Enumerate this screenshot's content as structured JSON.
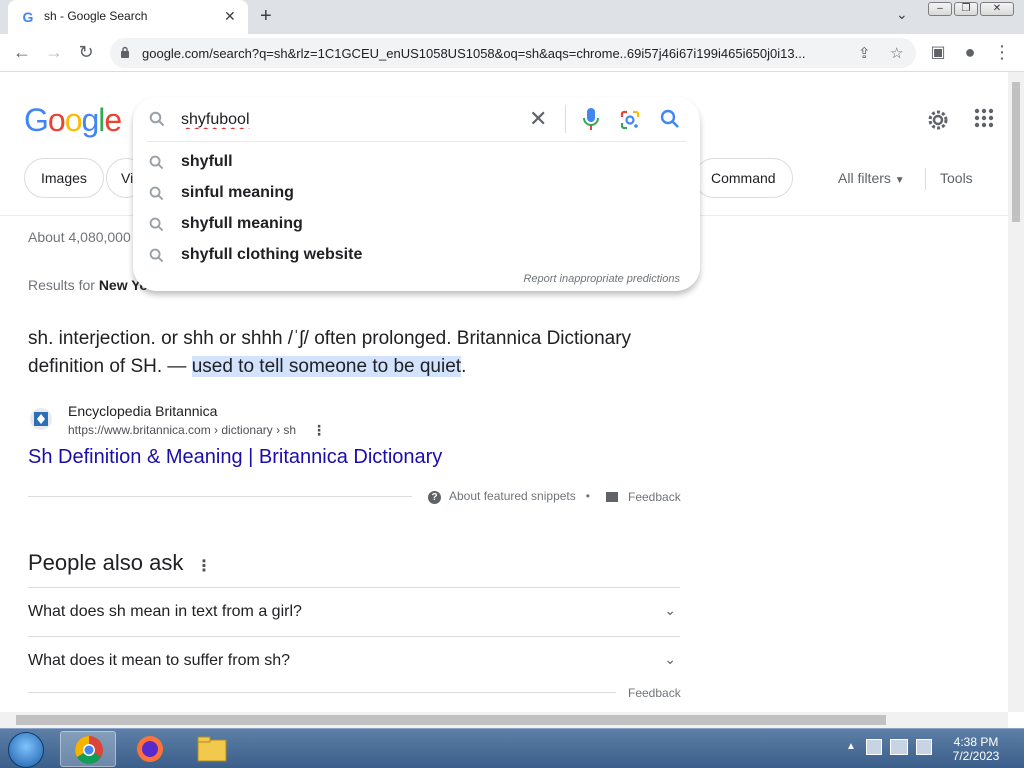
{
  "browser": {
    "tab_title": "sh - Google Search",
    "favicon_letter": "G",
    "close_tab": "✕",
    "new_tab": "+",
    "url": "google.com/search?q=sh&rlz=1C1GCEU_enUS1058US1058&oq=sh&aqs=chrome..69i57j46i67i199i465i650j0i13..."
  },
  "header": {
    "logo_letters": [
      "G",
      "o",
      "o",
      "g",
      "l",
      "e"
    ],
    "logo_colors": [
      "#4285f4",
      "#ea4335",
      "#fbbc05",
      "#4285f4",
      "#34a853",
      "#ea4335"
    ]
  },
  "search": {
    "query": "shyfubool",
    "clear_glyph": "✕",
    "suggestions": [
      "shyfull",
      "sinful meaning",
      "shyfull meaning",
      "shyfull clothing website"
    ],
    "report": "Report inappropriate predictions"
  },
  "filters": {
    "chip_images": "Images",
    "chip_videos_partial": "Vi",
    "chip_command": "Command",
    "all_filters": "All filters",
    "tools": "Tools"
  },
  "results": {
    "stats": "About 4,080,000",
    "results_for_prefix": "Results for",
    "results_for_place": "New Yo",
    "snippet_before": "sh. interjection. or shh or shhh /ˈʃ/ often prolonged. Britannica Dictionary definition of SH. — ",
    "snippet_highlight": "used to tell someone to be quiet",
    "snippet_after": ".",
    "source_name": "Encyclopedia Britannica",
    "source_url": "https://www.britannica.com › dictionary › sh",
    "link_title": "Sh Definition & Meaning | Britannica Dictionary",
    "about_snippets": "About featured snippets",
    "feedback": "Feedback"
  },
  "paa": {
    "title": "People also ask",
    "questions": [
      "What does sh mean in text from a girl?",
      "What does it mean to suffer from sh?"
    ],
    "feedback": "Feedback"
  },
  "taskbar": {
    "time": "4:38 PM",
    "date": "7/2/2023"
  }
}
